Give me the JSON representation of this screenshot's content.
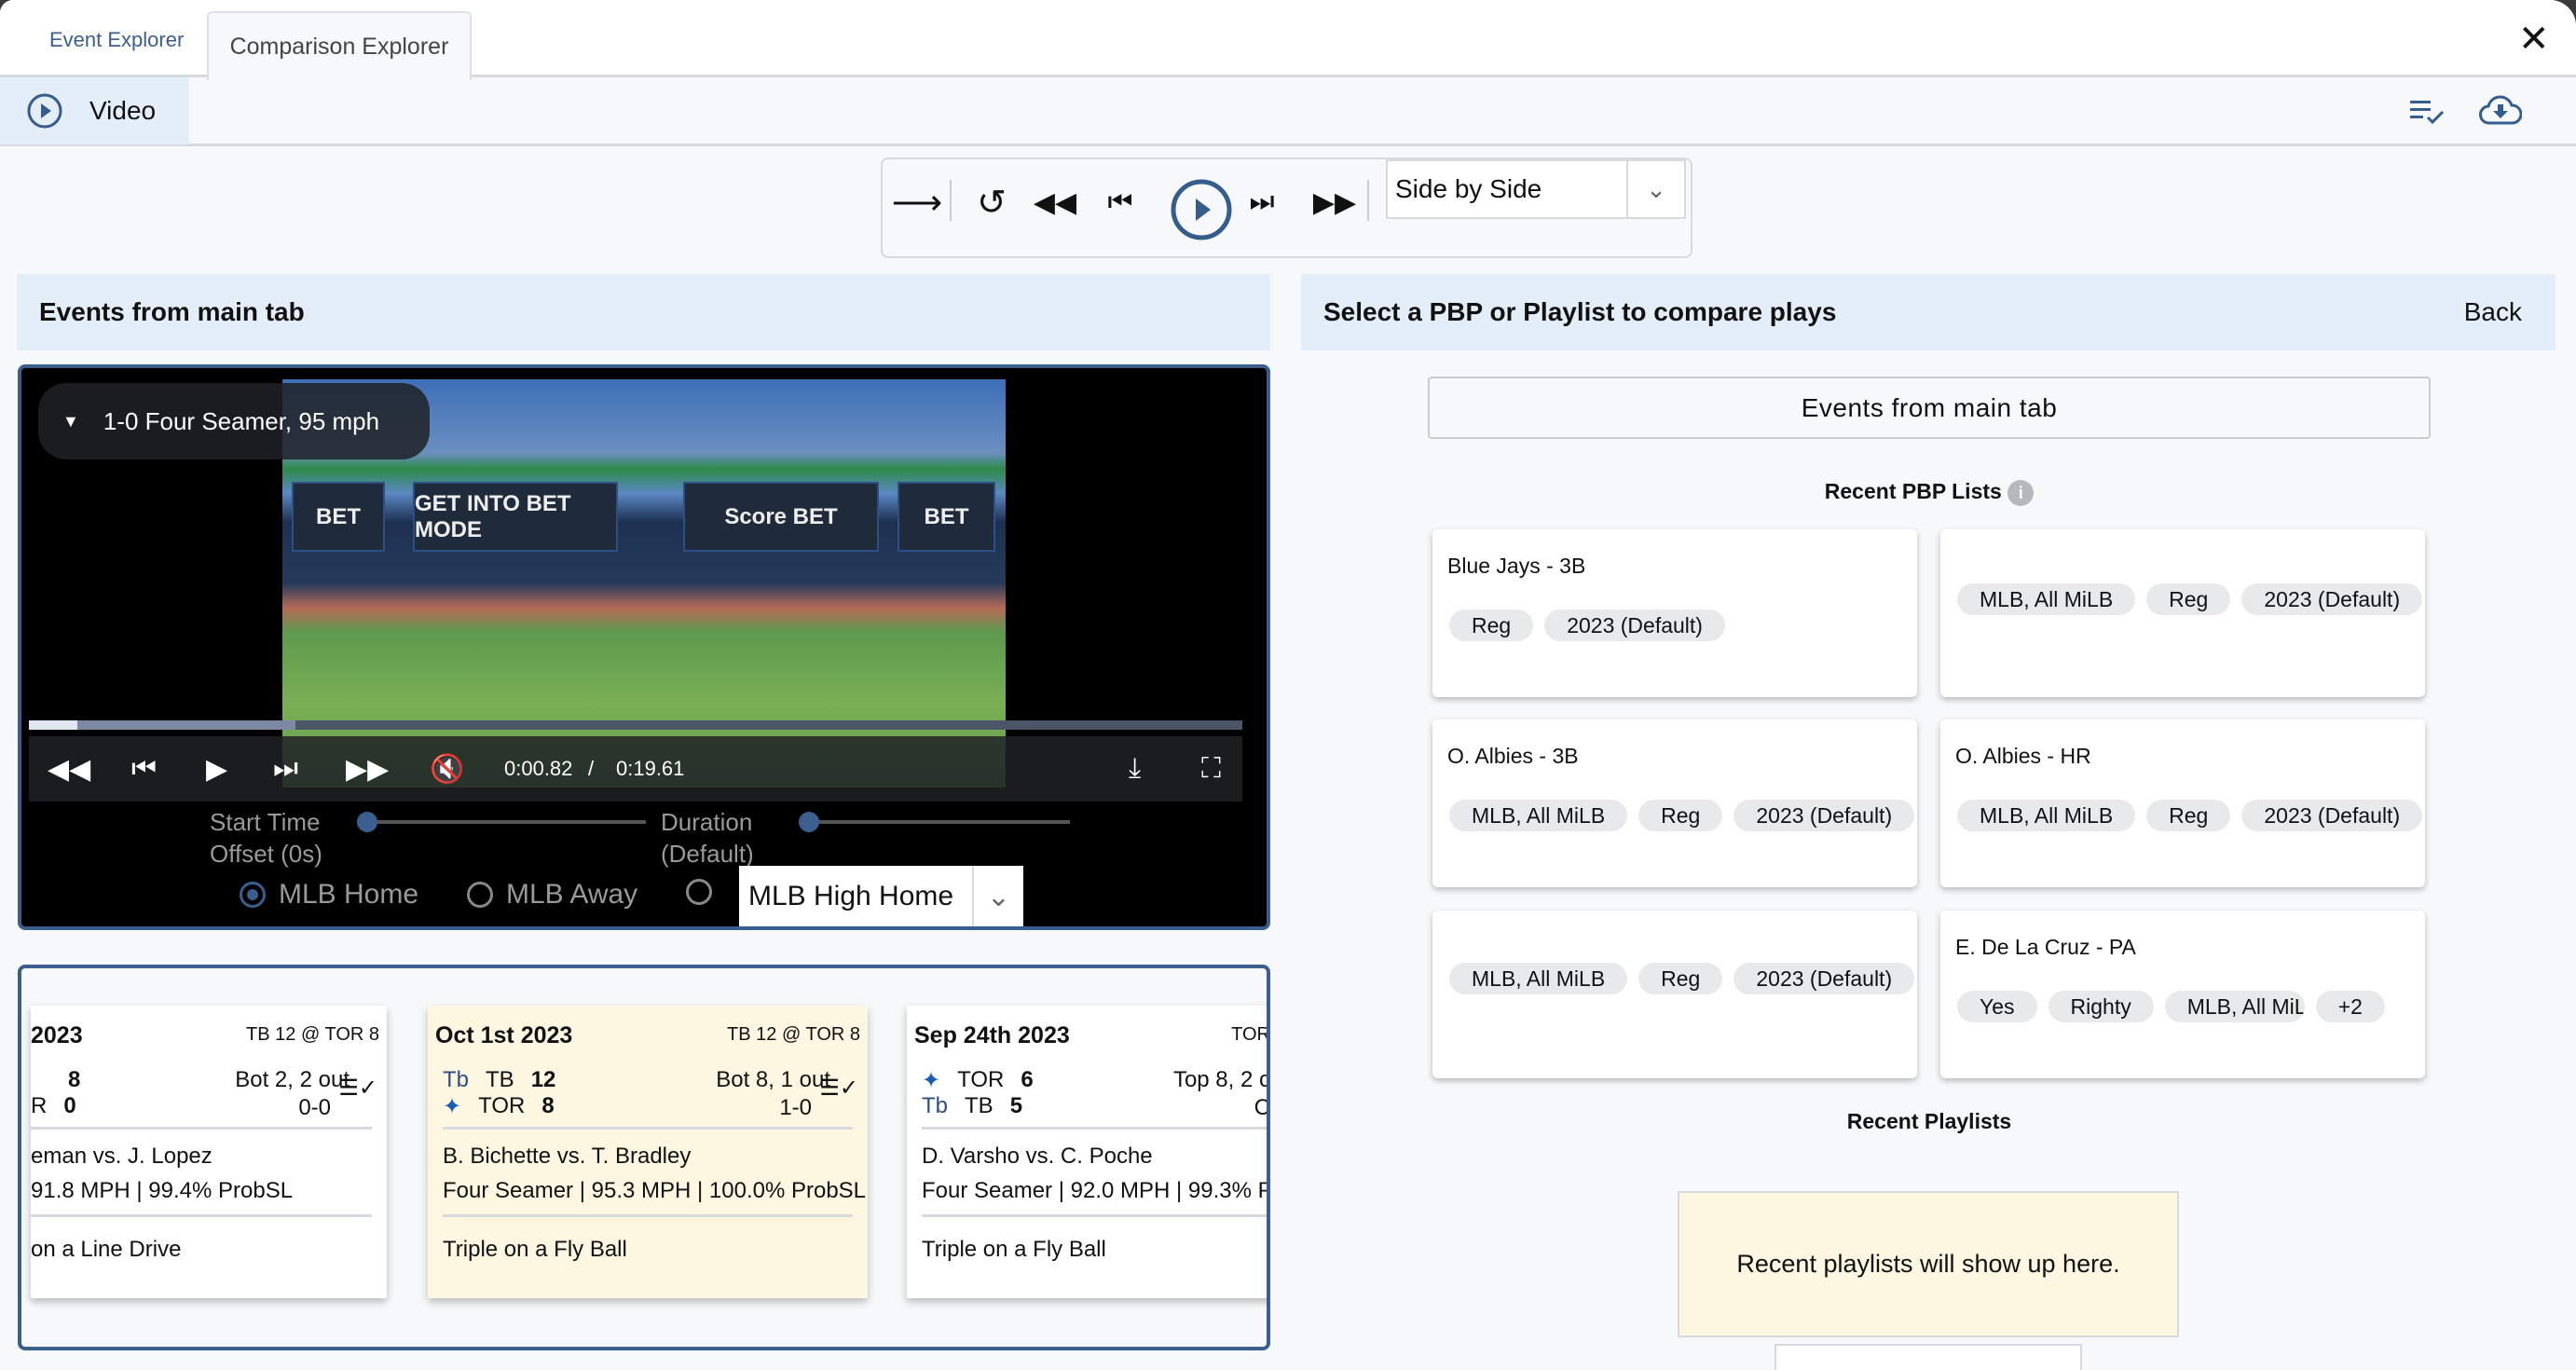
{
  "tabs": [
    {
      "label": "Event Explorer",
      "active": false
    },
    {
      "label": "Comparison Explorer",
      "active": true
    }
  ],
  "subtab": {
    "label": "Video",
    "icon": "play-circle-icon"
  },
  "toolbar_icons": [
    "playlist-check-icon",
    "cloud-download-icon",
    "close-icon"
  ],
  "playback": {
    "view_mode": "Side by Side",
    "icons": [
      "arrow-right-icon",
      "replay-icon",
      "rewind-icon",
      "skip-previous-icon",
      "play-circle-icon",
      "skip-next-icon",
      "fast-forward-icon"
    ]
  },
  "left": {
    "header": "Events from main tab",
    "video": {
      "title": "1-0 Four Seamer, 95 mph",
      "current_time": "0:00.82",
      "separator": "/",
      "duration": "0:19.61",
      "progress": 0.04,
      "start_offset_label": "Start Time Offset (0s)",
      "start_offset_label_1": "Start Time",
      "start_offset_label_2": "Offset (0s)",
      "duration_label_1": "Duration",
      "duration_label_2": "(Default)",
      "feeds": [
        {
          "label": "MLB Home",
          "selected": true
        },
        {
          "label": "MLB Away",
          "selected": false
        }
      ],
      "feed_select": "MLB High Home",
      "billboards": [
        "BET",
        "GET INTO BET MODE",
        "Score BET",
        "BET"
      ]
    },
    "events": [
      {
        "date": "2023",
        "game": "TB 12 @ TOR 8",
        "teams": [
          {
            "abbr": "",
            "score": "8"
          },
          {
            "abbr": "R",
            "score": "0"
          }
        ],
        "inning": "Bot 2, 2 out",
        "count": "0-0",
        "matchup": "eman vs. J. Lopez",
        "pitch": "91.8 MPH | 99.4% ProbSL",
        "result": "on a Line Drive"
      },
      {
        "date": "Oct 1st 2023",
        "game": "TB 12 @ TOR 8",
        "teams": [
          {
            "abbr": "TB",
            "score": "12"
          },
          {
            "abbr": "TOR",
            "score": "8"
          }
        ],
        "inning": "Bot 8, 1 out",
        "count": "1-0",
        "matchup": "B. Bichette vs. T. Bradley",
        "pitch": "Four Seamer | 95.3 MPH | 100.0% ProbSL",
        "result": "Triple on a Fly Ball",
        "selected": true
      },
      {
        "date": "Sep 24th 2023",
        "game": "TOR",
        "teams": [
          {
            "abbr": "TOR",
            "score": "6"
          },
          {
            "abbr": "TB",
            "score": "5"
          }
        ],
        "inning": "Top 8, 2 c",
        "count": "C",
        "matchup": "D. Varsho vs. C. Poche",
        "pitch": "Four Seamer | 92.0 MPH | 99.3% Pr",
        "result": "Triple on a Fly Ball"
      }
    ]
  },
  "right": {
    "header": "Select a PBP or Playlist to compare plays",
    "back": "Back",
    "main_tab_button": "Events from main tab",
    "recent_pbp_title": "Recent PBP Lists",
    "pbp_lists": [
      {
        "name": "Blue Jays - 3B",
        "tags": [
          "Reg",
          "2023 (Default)"
        ]
      },
      {
        "name": "",
        "tags": [
          "MLB, All MiLB",
          "Reg",
          "2023 (Default)"
        ]
      },
      {
        "name": "O. Albies - 3B",
        "tags": [
          "MLB, All MiLB",
          "Reg",
          "2023 (Default)"
        ]
      },
      {
        "name": "O. Albies - HR",
        "tags": [
          "MLB, All MiLB",
          "Reg",
          "2023 (Default)"
        ]
      },
      {
        "name": "",
        "tags": [
          "MLB, All MiLB",
          "Reg",
          "2023 (Default)"
        ]
      },
      {
        "name": "E. De La Cruz - PA",
        "tags": [
          "Yes",
          "Righty",
          "MLB, All MiLB",
          "+2"
        ]
      }
    ],
    "recent_playlists_title": "Recent Playlists",
    "playlists_empty": "Recent playlists will show up here."
  },
  "colors": {
    "accent": "#3a5f8f",
    "header_bg": "#e4eef8",
    "selected_card": "#fdf6e1"
  }
}
